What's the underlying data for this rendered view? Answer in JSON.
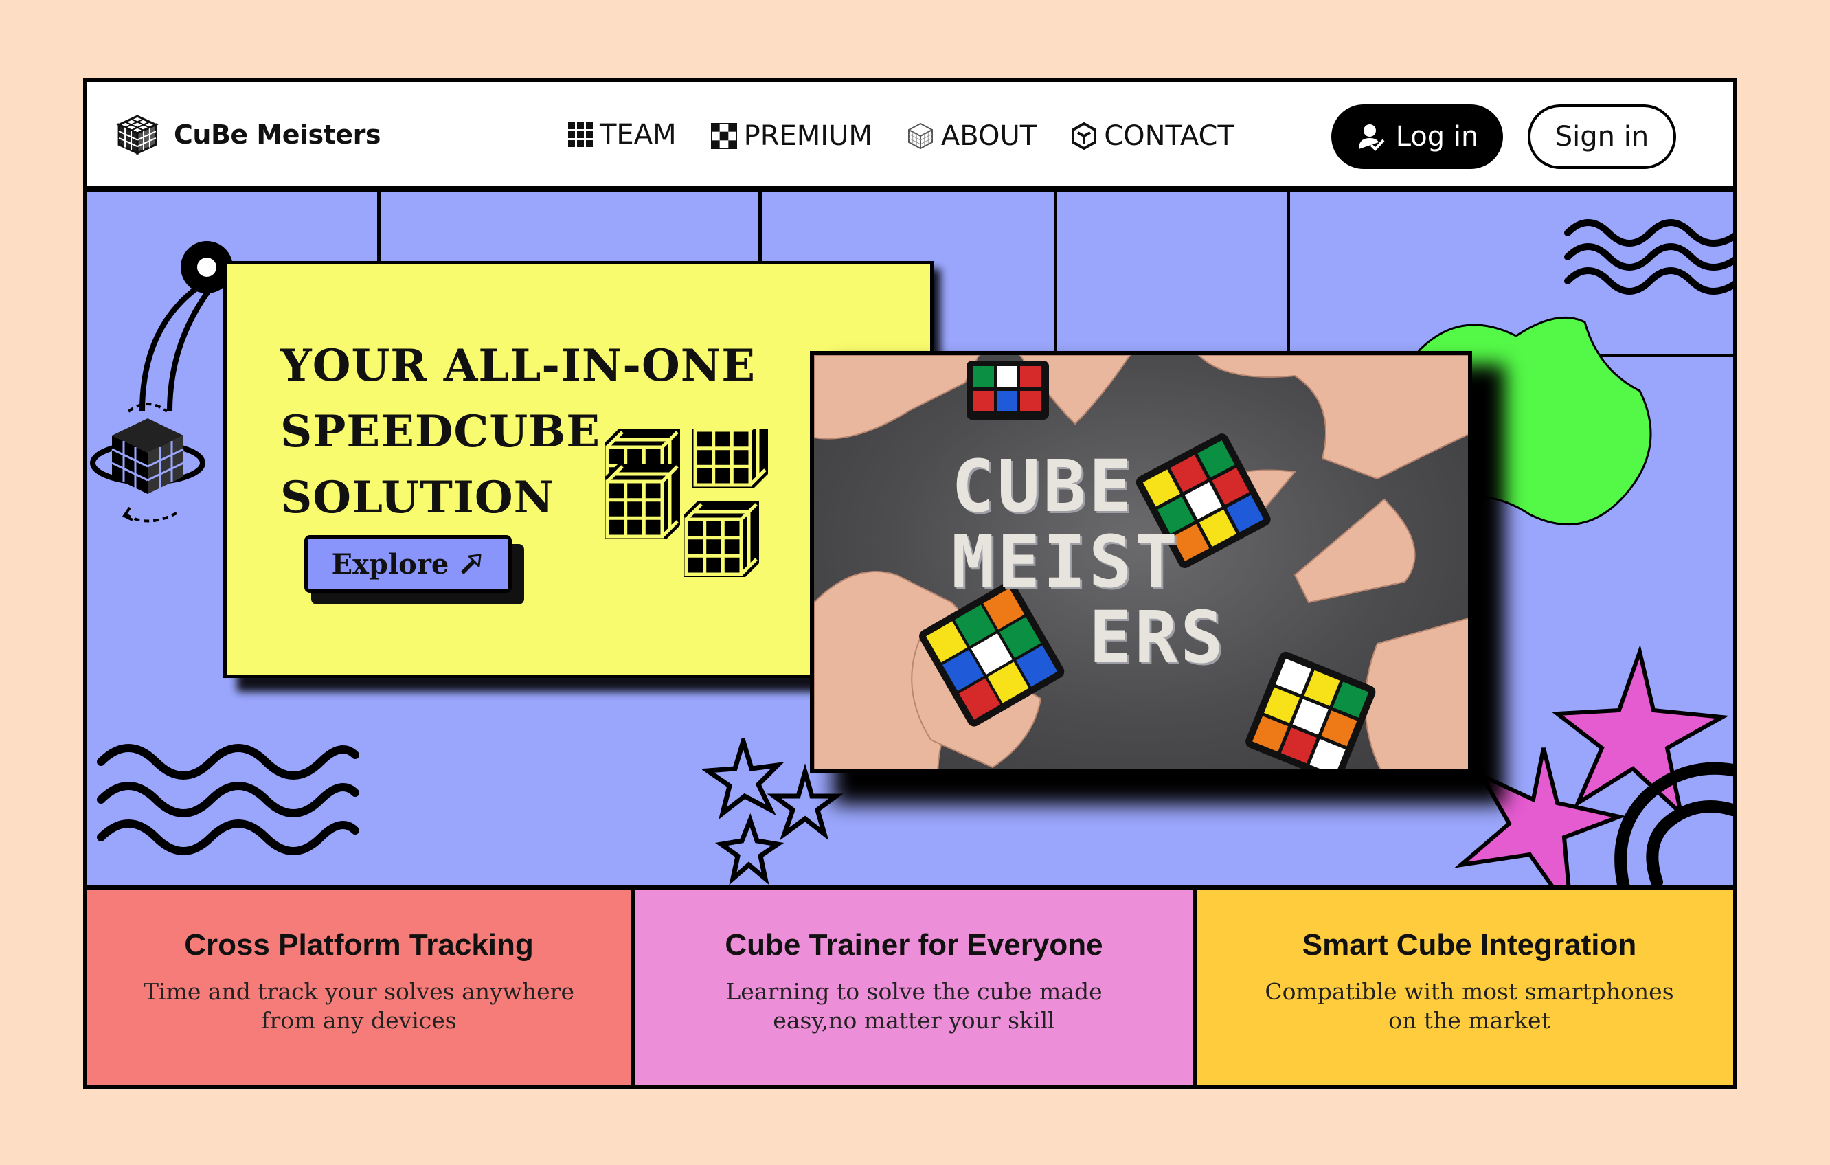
{
  "brand": {
    "name": "CuBe Meisters",
    "logo_icon": "cube-logo-icon"
  },
  "nav": {
    "links": [
      {
        "label": "TEAM",
        "icon": "grid-icon"
      },
      {
        "label": "PREMIUM",
        "icon": "checker-icon"
      },
      {
        "label": "ABOUT",
        "icon": "wireframe-cube-icon"
      },
      {
        "label": "CONTACT",
        "icon": "hex-cube-icon"
      }
    ],
    "login_label": "Log in",
    "signin_label": "Sign in"
  },
  "hero": {
    "headline": [
      "YOUR ALL-IN-ONE",
      "SPEEDCUBE",
      "SOLUTION"
    ],
    "explore_label": "Explore",
    "photo_text": [
      "CUBE",
      "MEIST",
      "ERS"
    ]
  },
  "features": [
    {
      "title": "Cross Platform Tracking",
      "desc": [
        "Time and track your solves anywhere",
        "from any devices"
      ],
      "color": "#f67c79"
    },
    {
      "title": "Cube Trainer for Everyone",
      "desc": [
        "Learning to solve the cube made",
        "easy,no matter your skill"
      ],
      "color": "#ec8ed8"
    },
    {
      "title": "Smart Cube Integration",
      "desc": [
        "Compatible with most smartphones",
        "on the market"
      ],
      "color": "#ffcc3d"
    }
  ],
  "colors": {
    "page": "#fddec4",
    "hero": "#9aa6fc",
    "yellow": "#f9fb6e",
    "green_blob": "#54f947",
    "star": "#e55bd0"
  }
}
